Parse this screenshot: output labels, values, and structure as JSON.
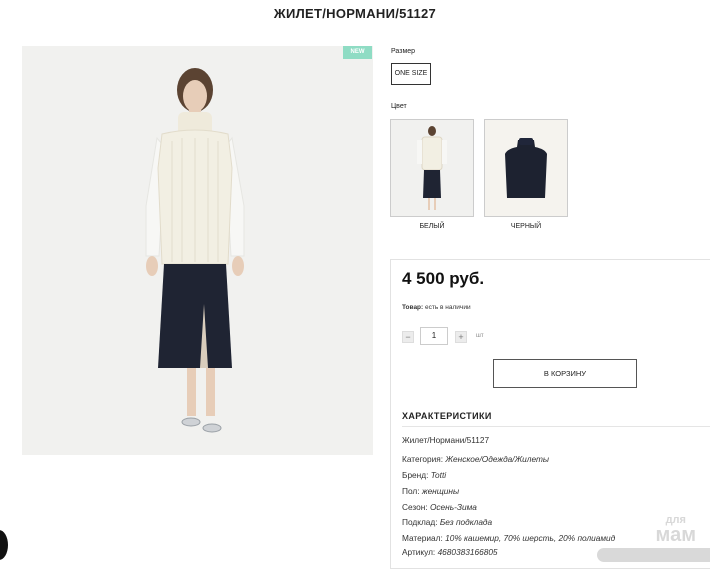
{
  "page": {
    "title": "ЖИЛЕТ/НОРМАНИ/51127",
    "badge": "NEW"
  },
  "size": {
    "label": "Размер",
    "options": [
      "ONE SIZE"
    ]
  },
  "color": {
    "label": "Цвет",
    "options": [
      {
        "name": "БЕЛЫЙ",
        "swatch": "#f3f0e6"
      },
      {
        "name": "ЧЕРНЫЙ",
        "swatch": "#1d2230"
      }
    ]
  },
  "buy": {
    "price": "4 500 руб.",
    "stock_label": "Товар:",
    "stock_value": "есть в наличии",
    "qty_minus": "−",
    "qty_value": "1",
    "qty_plus": "+",
    "qty_unit": "шт",
    "cart_button": "В КОРЗИНУ"
  },
  "specs": {
    "title": "ХАРАКТЕРИСТИКИ",
    "name": "Жилет/Нормани/51127",
    "rows": [
      {
        "key": "Категория:",
        "value": "Женское/Одежда/Жилеты"
      },
      {
        "key": "Бренд:",
        "value": "Totti"
      },
      {
        "key": "Пол:",
        "value": "женщины"
      },
      {
        "key": "Сезон:",
        "value": "Осень-Зима"
      },
      {
        "key": "Подклад:",
        "value": "Без подклада"
      },
      {
        "key": "Материал:",
        "value": "10% кашемир, 70% шерсть, 20% полиамид"
      },
      {
        "key": "Артикул:",
        "value": "4680383166805"
      }
    ]
  },
  "watermark": {
    "line1": "для",
    "line2": "мам"
  },
  "colors": {
    "badge": "#8fdcc4",
    "skirt": "#1f2433",
    "sweater": "#f2efe3"
  }
}
